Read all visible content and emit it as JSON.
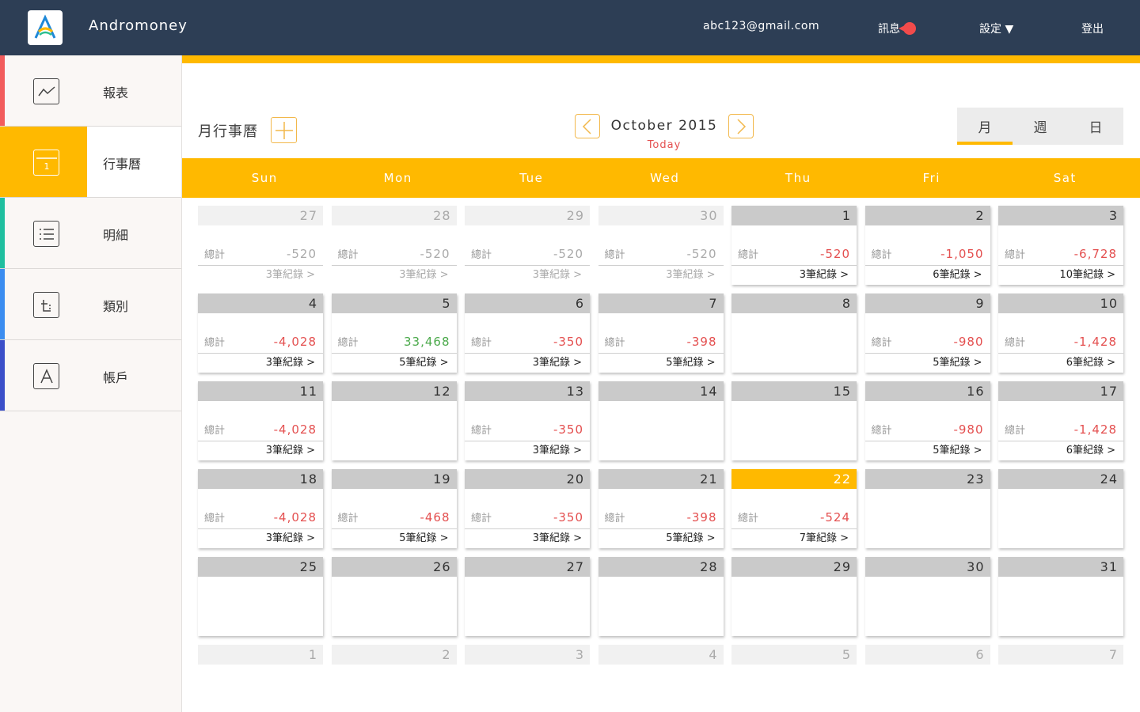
{
  "app": {
    "title": "Andromoney"
  },
  "header": {
    "email": "abc123@gmail.com",
    "messages_label": "訊息",
    "settings_label": "設定 ▼",
    "logout_label": "登出"
  },
  "sidebar": {
    "items": [
      {
        "label": "報表",
        "icon": "chart-icon",
        "color": "#f25c5c"
      },
      {
        "label": "行事曆",
        "icon": "calendar-icon",
        "color": "#ffb900"
      },
      {
        "label": "明細",
        "icon": "list-icon",
        "color": "#1fbf9f"
      },
      {
        "label": "類別",
        "icon": "category-icon",
        "color": "#3b8df0"
      },
      {
        "label": "帳戶",
        "icon": "account-icon",
        "color": "#3b4fc9"
      }
    ]
  },
  "main": {
    "title": "月行事曆",
    "month_label": "October 2015",
    "today_label": "Today",
    "view_tabs": [
      "月",
      "週",
      "日"
    ],
    "weekdays": [
      "Sun",
      "Mon",
      "Tue",
      "Wed",
      "Thu",
      "Fri",
      "Sat"
    ],
    "total_label": "總計",
    "accent": "#ffb900"
  },
  "calendar": {
    "weeks": [
      [
        {
          "day": "27",
          "other": true,
          "total": "-520",
          "records": "3筆紀錄 >"
        },
        {
          "day": "28",
          "other": true,
          "total": "-520",
          "records": "3筆紀錄 >"
        },
        {
          "day": "29",
          "other": true,
          "total": "-520",
          "records": "3筆紀錄 >"
        },
        {
          "day": "30",
          "other": true,
          "total": "-520",
          "records": "3筆紀錄 >"
        },
        {
          "day": "1",
          "total": "-520",
          "records": "3筆紀錄 >"
        },
        {
          "day": "2",
          "total": "-1,050",
          "records": "6筆紀錄 >"
        },
        {
          "day": "3",
          "total": "-6,728",
          "records": "10筆紀錄 >"
        }
      ],
      [
        {
          "day": "4",
          "total": "-4,028",
          "records": "3筆紀錄 >"
        },
        {
          "day": "5",
          "total": "33,468",
          "records": "5筆紀錄 >",
          "positive": true
        },
        {
          "day": "6",
          "total": "-350",
          "records": "3筆紀錄 >"
        },
        {
          "day": "7",
          "total": "-398",
          "records": "5筆紀錄 >"
        },
        {
          "day": "8"
        },
        {
          "day": "9",
          "total": "-980",
          "records": "5筆紀錄 >"
        },
        {
          "day": "10",
          "total": "-1,428",
          "records": "6筆紀錄 >"
        }
      ],
      [
        {
          "day": "11",
          "total": "-4,028",
          "records": "3筆紀錄 >"
        },
        {
          "day": "12"
        },
        {
          "day": "13",
          "total": "-350",
          "records": "3筆紀錄 >"
        },
        {
          "day": "14"
        },
        {
          "day": "15"
        },
        {
          "day": "16",
          "total": "-980",
          "records": "5筆紀錄 >"
        },
        {
          "day": "17",
          "total": "-1,428",
          "records": "6筆紀錄 >"
        }
      ],
      [
        {
          "day": "18",
          "total": "-4,028",
          "records": "3筆紀錄 >"
        },
        {
          "day": "19",
          "total": "-468",
          "records": "5筆紀錄 >"
        },
        {
          "day": "20",
          "total": "-350",
          "records": "3筆紀錄 >"
        },
        {
          "day": "21",
          "total": "-398",
          "records": "5筆紀錄 >"
        },
        {
          "day": "22",
          "total": "-524",
          "records": "7筆紀錄 >",
          "today": true
        },
        {
          "day": "23"
        },
        {
          "day": "24"
        }
      ],
      [
        {
          "day": "25"
        },
        {
          "day": "26"
        },
        {
          "day": "27"
        },
        {
          "day": "28"
        },
        {
          "day": "29"
        },
        {
          "day": "30"
        },
        {
          "day": "31"
        }
      ],
      [
        {
          "day": "1",
          "other": true
        },
        {
          "day": "2",
          "other": true
        },
        {
          "day": "3",
          "other": true
        },
        {
          "day": "4",
          "other": true
        },
        {
          "day": "5",
          "other": true
        },
        {
          "day": "6",
          "other": true
        },
        {
          "day": "7",
          "other": true
        }
      ]
    ]
  }
}
